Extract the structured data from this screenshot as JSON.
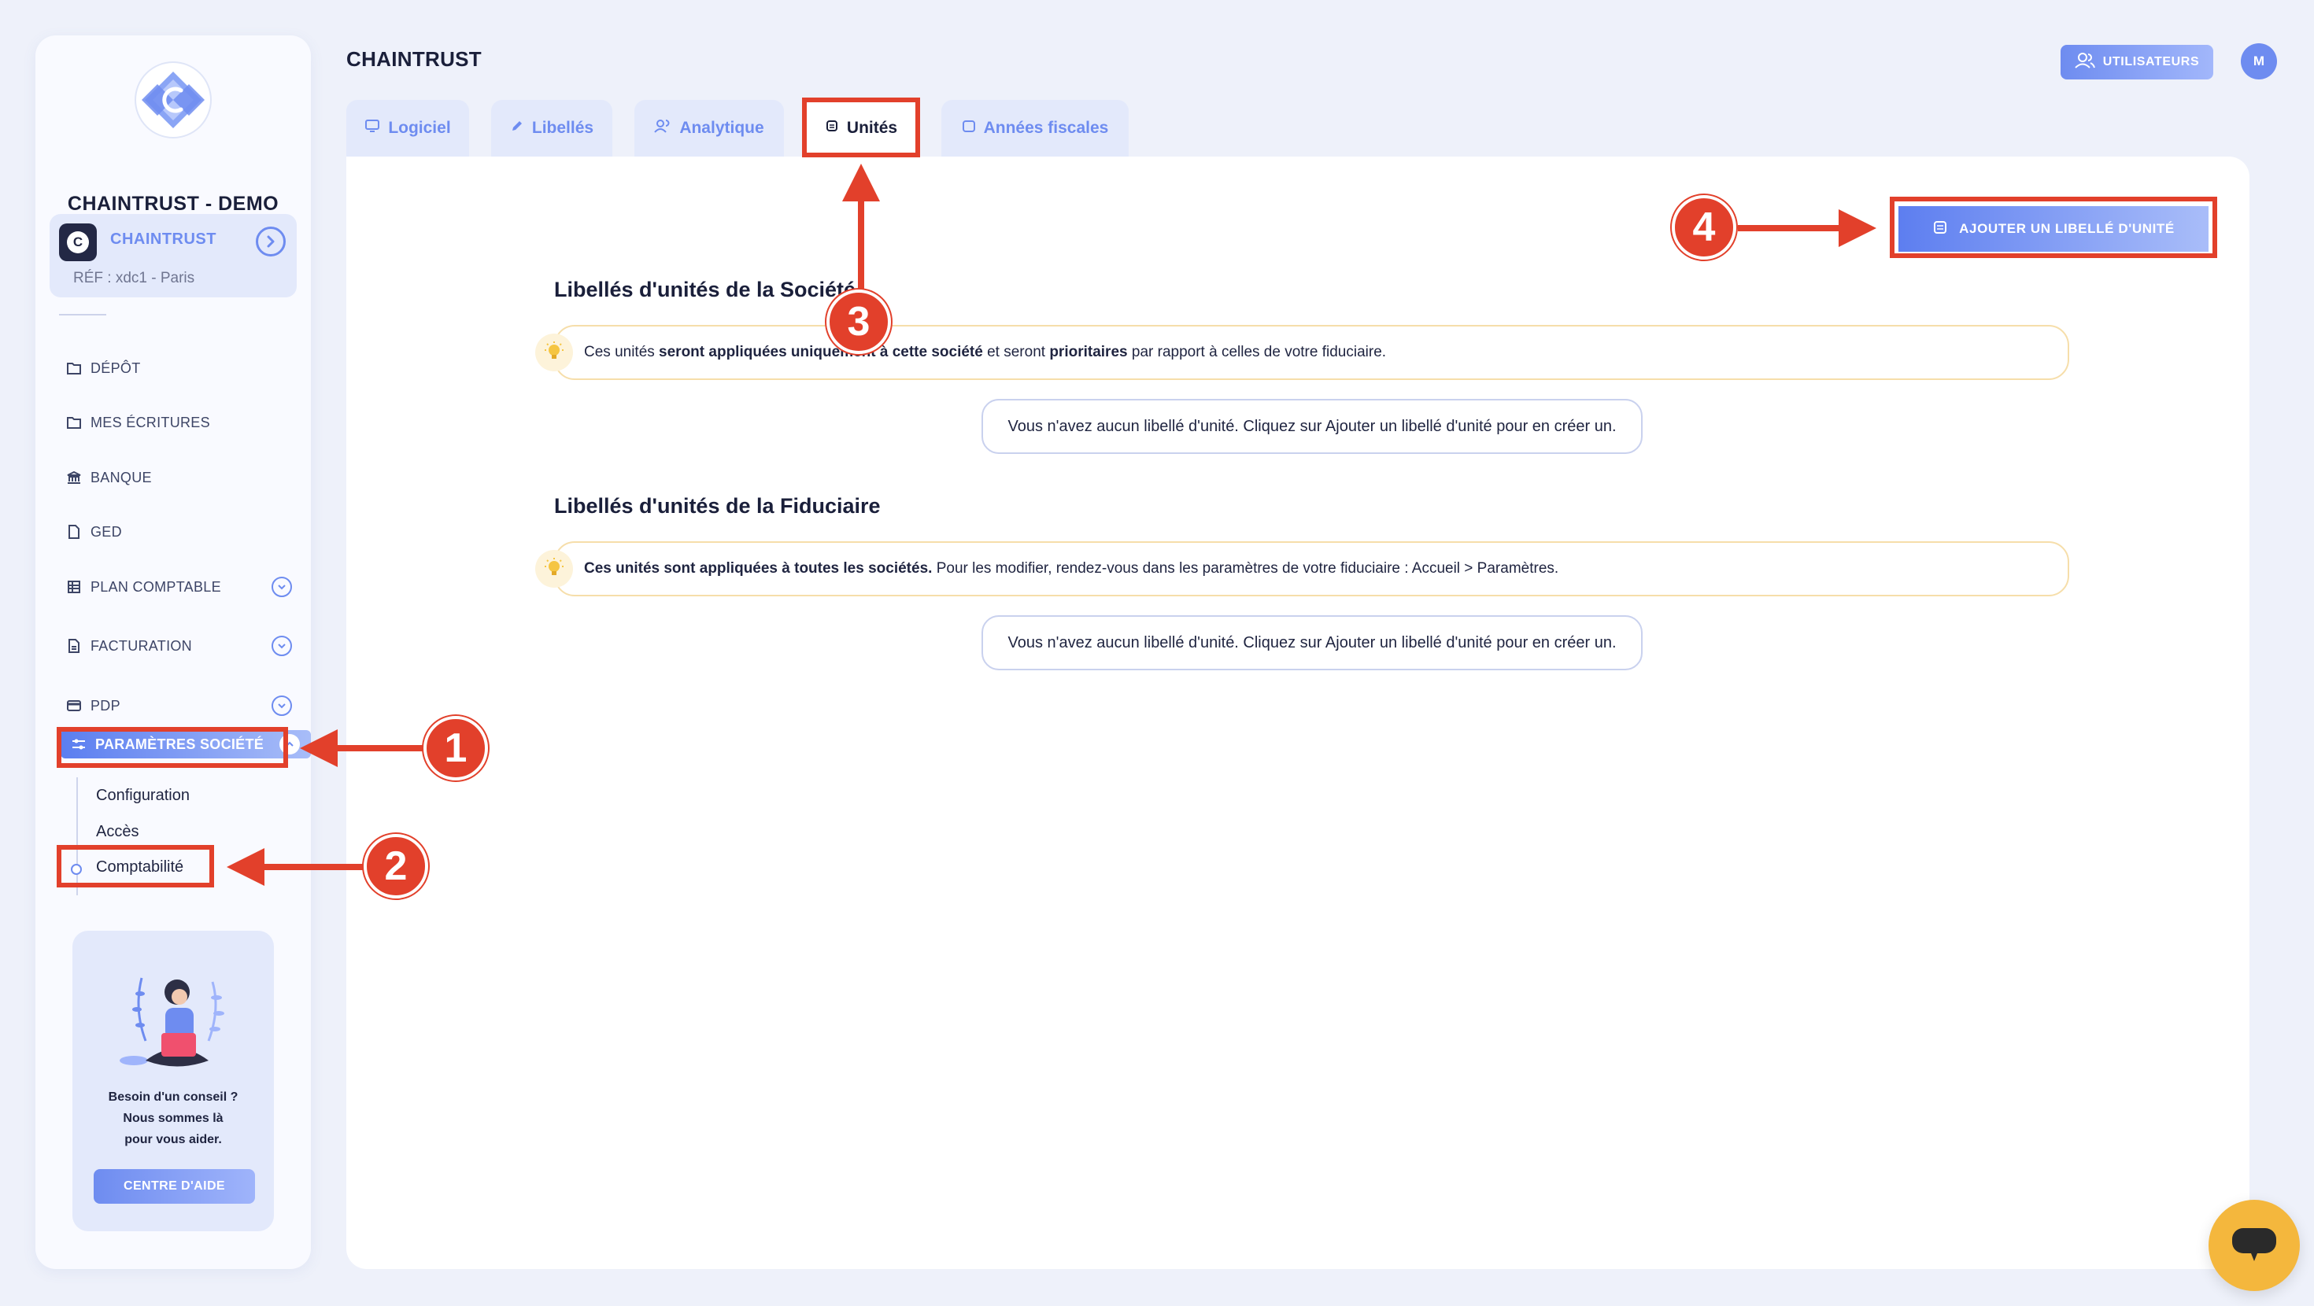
{
  "sidebar": {
    "company_title": "CHAINTRUST - DEMO",
    "company_card": {
      "avatar_letter": "C",
      "name": "CHAINTRUST",
      "ref": "RÉF : xdc1 - Paris"
    },
    "nav": [
      {
        "label": "DÉPÔT",
        "icon": "folder-icon"
      },
      {
        "label": "MES ÉCRITURES",
        "icon": "folder-icon"
      },
      {
        "label": "BANQUE",
        "icon": "bank-icon"
      },
      {
        "label": "GED",
        "icon": "document-icon"
      },
      {
        "label": "PLAN COMPTABLE",
        "icon": "ledger-icon",
        "expandable": true
      },
      {
        "label": "FACTURATION",
        "icon": "invoice-icon",
        "expandable": true
      },
      {
        "label": "PDP",
        "icon": "card-icon",
        "expandable": true
      }
    ],
    "active_section": {
      "label": "PARAMÈTRES SOCIÉTÉ",
      "icon": "settings-sliders-icon"
    },
    "sub_items": [
      "Configuration",
      "Accès",
      "Comptabilité"
    ],
    "help": {
      "line1": "Besoin d'un conseil ?",
      "line2": "Nous sommes là",
      "line3": "pour vous aider.",
      "button": "CENTRE D'AIDE"
    }
  },
  "header": {
    "title": "CHAINTRUST",
    "users_button": "UTILISATEURS",
    "avatar_letter": "M"
  },
  "tabs": [
    {
      "label": "Logiciel",
      "icon": "monitor-icon"
    },
    {
      "label": "Libellés",
      "icon": "pencil-icon"
    },
    {
      "label": "Analytique",
      "icon": "users-icon"
    },
    {
      "label": "Unités",
      "icon": "unit-icon",
      "active": true
    },
    {
      "label": "Années fiscales",
      "icon": "calendar-icon"
    }
  ],
  "main": {
    "add_button": "AJOUTER UN LIBELLÉ D'UNITÉ",
    "company_section": {
      "title": "Libellés d'unités de la Société",
      "info_parts": [
        "Ces unités ",
        "seront appliquées uniquement à cette société",
        " et seront ",
        "prioritaires",
        " par rapport à celles de votre fiduciaire."
      ],
      "empty": "Vous n'avez aucun libellé d'unité. Cliquez sur Ajouter un libellé d'unité pour en créer un."
    },
    "fiduciary_section": {
      "title": "Libellés d'unités de la Fiduciaire",
      "info_parts": [
        "Ces unités sont appliquées à toutes les sociétés.",
        " Pour les modifier, rendez-vous dans les paramètres de votre fiduciaire : Accueil > Paramètres."
      ],
      "empty": "Vous n'avez aucun libellé d'unité. Cliquez sur Ajouter un libellé d'unité pour en créer un."
    }
  },
  "annotations": {
    "step1": "1",
    "step2": "2",
    "step3": "3",
    "step4": "4"
  },
  "colors": {
    "accent": "#6e8cf0",
    "annotation": "#e2402b",
    "background": "#eef1fa",
    "chat": "#f4b73d"
  }
}
